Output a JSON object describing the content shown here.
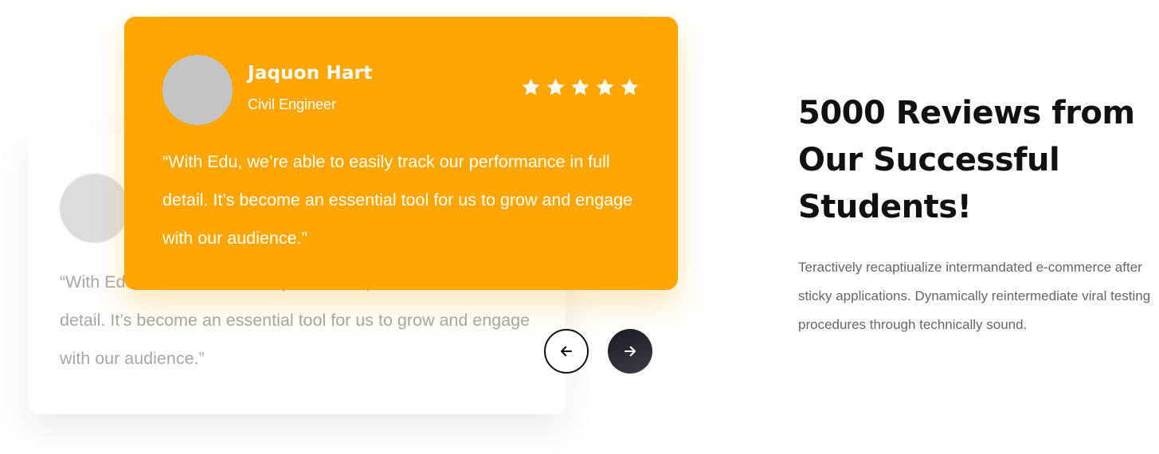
{
  "testimonials": {
    "active": {
      "name": "Jaquon Hart",
      "role": "Civil Engineer",
      "rating": 5,
      "quote": "“With Edu, we’re able to easily track our performance in full detail. It’s become an essential tool for us to grow and engage with our audience.”"
    },
    "previous": {
      "quote": "“With Edu, we’re able to easily track our performance in full detail. It’s become an essential tool for us to grow and engage with our audience.”"
    }
  },
  "colors": {
    "accent": "#ffa600",
    "heading": "#111111",
    "body_text": "#666666"
  },
  "icons": {
    "prev": "arrow-left-icon",
    "next": "arrow-right-icon",
    "rating": "star-icon"
  },
  "section": {
    "heading": "5000 Reviews from Our Successful Students!",
    "description": "Teractively recaptiualize intermandated e-commerce after sticky applications. Dynamically reintermediate viral testing procedures through technically sound."
  }
}
